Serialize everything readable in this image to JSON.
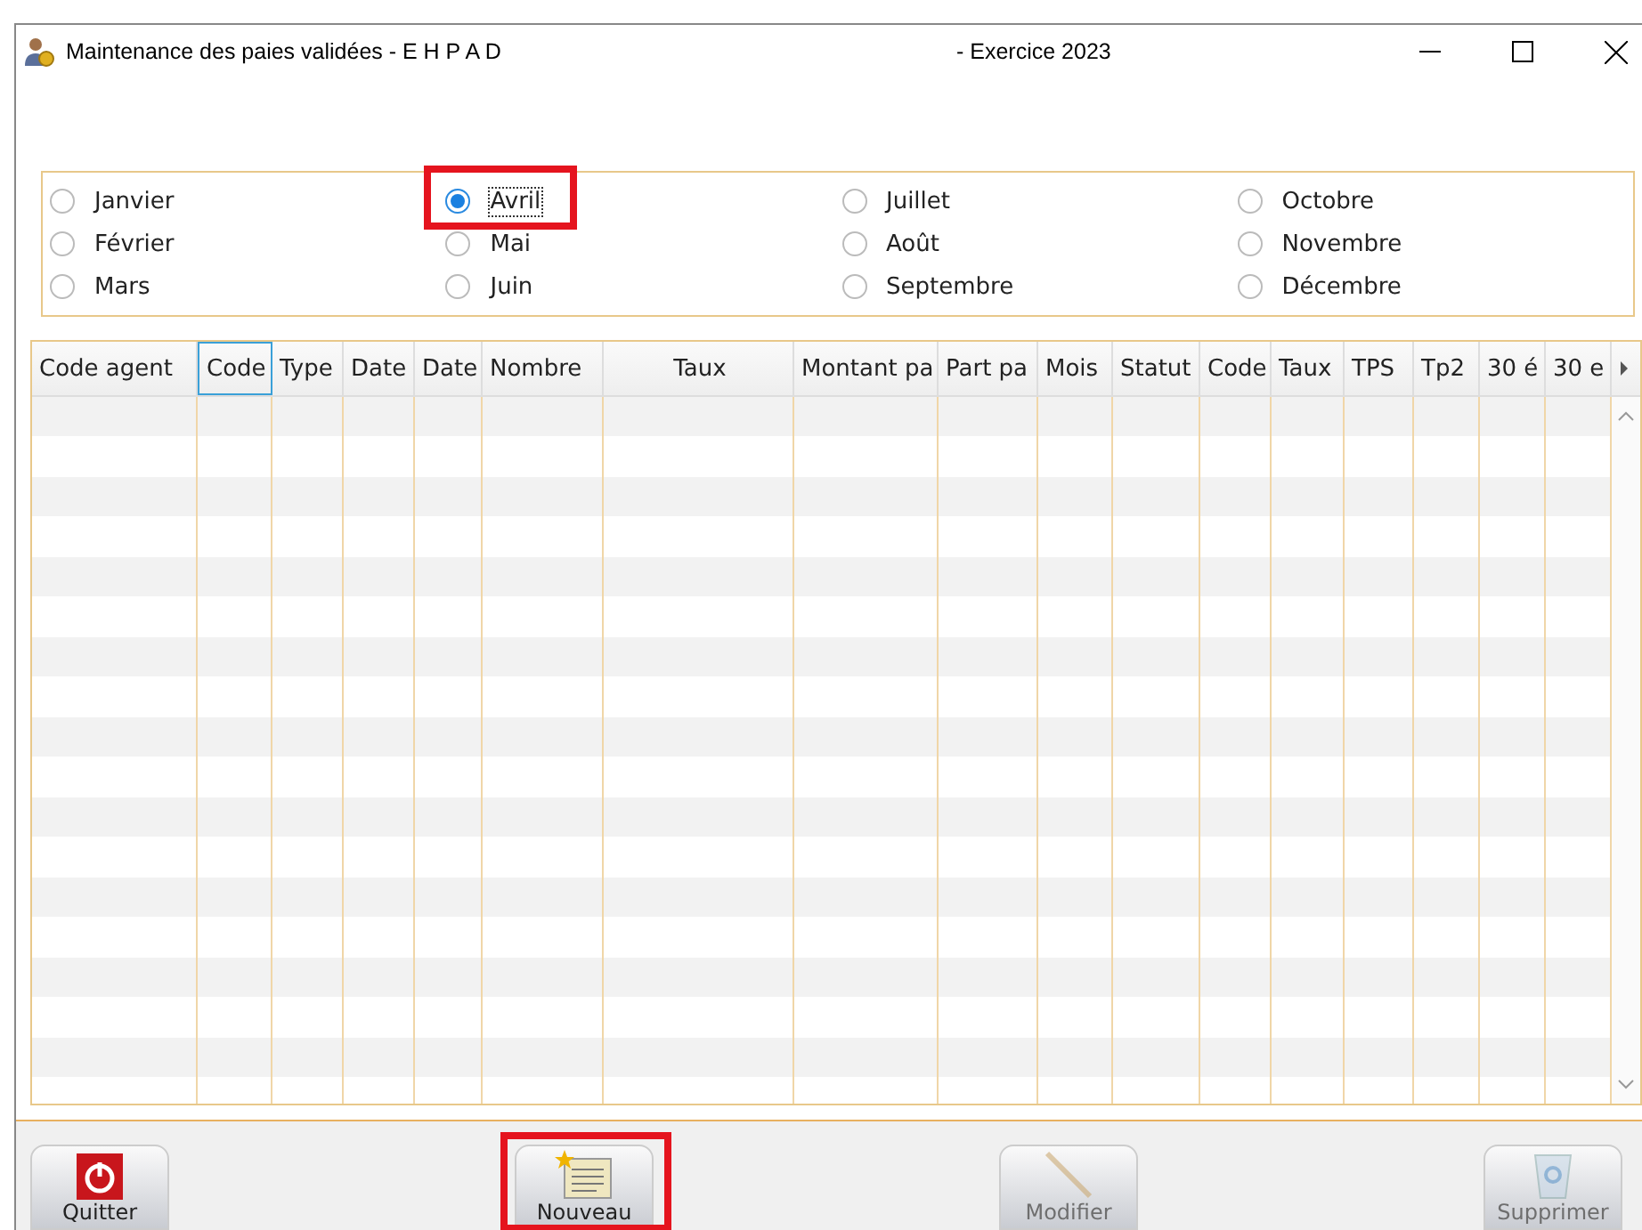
{
  "window": {
    "title": "Maintenance des paies validées -  E H P A D",
    "subtitle": "-  Exercice  2023"
  },
  "months": [
    {
      "label": "Janvier",
      "selected": false,
      "highlighted": false
    },
    {
      "label": "Février",
      "selected": false,
      "highlighted": false
    },
    {
      "label": "Mars",
      "selected": false,
      "highlighted": false
    },
    {
      "label": "Avril",
      "selected": true,
      "highlighted": true
    },
    {
      "label": "Mai",
      "selected": false,
      "highlighted": false
    },
    {
      "label": "Juin",
      "selected": false,
      "highlighted": false
    },
    {
      "label": "Juillet",
      "selected": false,
      "highlighted": false
    },
    {
      "label": "Août",
      "selected": false,
      "highlighted": false
    },
    {
      "label": "Septembre",
      "selected": false,
      "highlighted": false
    },
    {
      "label": "Octobre",
      "selected": false,
      "highlighted": false
    },
    {
      "label": "Novembre",
      "selected": false,
      "highlighted": false
    },
    {
      "label": "Décembre",
      "selected": false,
      "highlighted": false
    }
  ],
  "table": {
    "columns": [
      {
        "label": "Code agent",
        "selected": false
      },
      {
        "label": "Code",
        "selected": true
      },
      {
        "label": "Type",
        "selected": false
      },
      {
        "label": "Date",
        "selected": false
      },
      {
        "label": "Date",
        "selected": false
      },
      {
        "label": "Nombre",
        "selected": false
      },
      {
        "label": "Taux",
        "selected": false
      },
      {
        "label": "Montant pa",
        "selected": false
      },
      {
        "label": "Part pa",
        "selected": false
      },
      {
        "label": "Mois",
        "selected": false
      },
      {
        "label": "Statut",
        "selected": false
      },
      {
        "label": "Code",
        "selected": false
      },
      {
        "label": "Taux",
        "selected": false
      },
      {
        "label": "TPS",
        "selected": false
      },
      {
        "label": "Tp2",
        "selected": false
      },
      {
        "label": "30 é",
        "selected": false
      },
      {
        "label": "30 e",
        "selected": false
      }
    ]
  },
  "buttons": [
    {
      "label": "Quitter",
      "kind": "quit",
      "disabled": false,
      "highlighted": false
    },
    {
      "label": "Nouveau",
      "kind": "new",
      "disabled": false,
      "highlighted": true
    },
    {
      "label": "Modifier",
      "kind": "edit",
      "disabled": true,
      "highlighted": false
    },
    {
      "label": "Supprimer",
      "kind": "delete",
      "disabled": true,
      "highlighted": false
    }
  ]
}
